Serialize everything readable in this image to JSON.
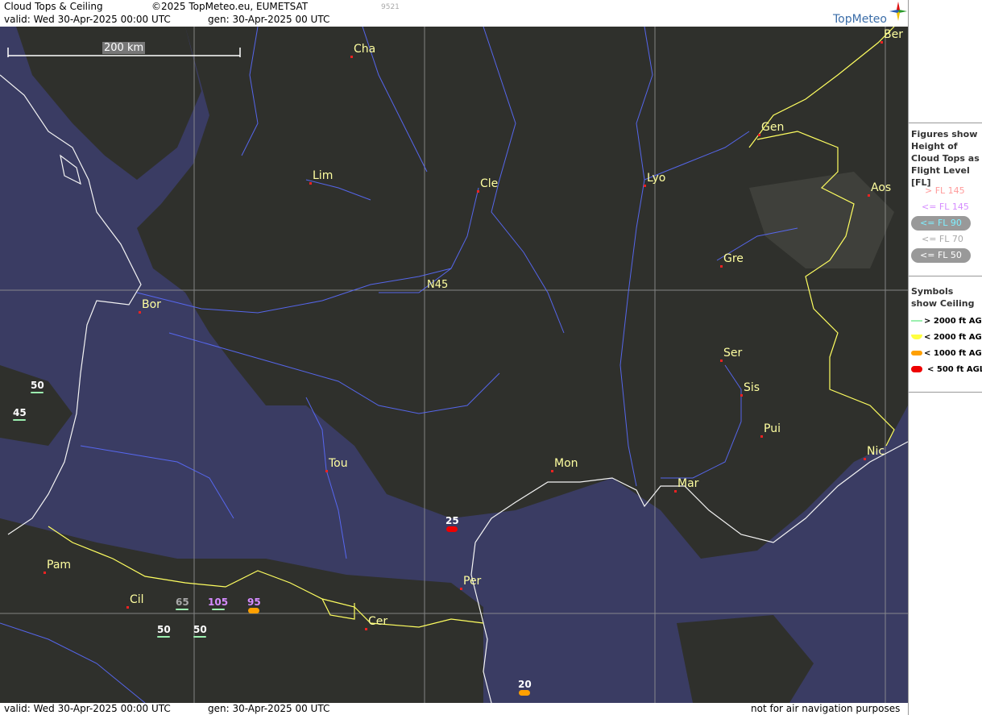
{
  "header": {
    "title": "Cloud Tops & Ceiling",
    "copyright": "©2025 TopMeteo.eu, EUMETSAT",
    "id_code": "9521",
    "valid": "valid:  Wed  30-Apr-2025  00:00 UTC",
    "generated": "gen: 30-Apr-2025 00 UTC",
    "logo": "TopMeteo"
  },
  "footer": {
    "valid": "valid:  Wed  30-Apr-2025  00:00 UTC",
    "generated": "gen: 30-Apr-2025 00 UTC",
    "disclaimer": "not for air navigation purposes"
  },
  "map": {
    "scale_label": "200 km",
    "lat_label": "N45",
    "colors": {
      "sea": "#3a3c63",
      "cloud": "#2e2e2c",
      "river": "#5a6cff",
      "border": "#ffff60",
      "coast": "#ffffff",
      "grid": "#9a9a9a"
    },
    "cities": [
      {
        "name": "Cha"
      },
      {
        "name": "Ber"
      },
      {
        "name": "Gen"
      },
      {
        "name": "Lim"
      },
      {
        "name": "Cle"
      },
      {
        "name": "Lyo"
      },
      {
        "name": "Aos"
      },
      {
        "name": "Gre"
      },
      {
        "name": "Bor"
      },
      {
        "name": "Ser"
      },
      {
        "name": "Sis"
      },
      {
        "name": "Pui"
      },
      {
        "name": "Nic"
      },
      {
        "name": "Tou"
      },
      {
        "name": "Mon"
      },
      {
        "name": "Mar"
      },
      {
        "name": "Pam"
      },
      {
        "name": "Cil"
      },
      {
        "name": "Cer"
      },
      {
        "name": "Per"
      }
    ],
    "observations": [
      {
        "fl": "50",
        "fl_class": "<= FL 50",
        "ceiling": "> 2000 ft AGL"
      },
      {
        "fl": "45",
        "fl_class": "<= FL 50",
        "ceiling": "> 2000 ft AGL"
      },
      {
        "fl": "65",
        "fl_class": "<= FL 70",
        "ceiling": "> 2000 ft AGL"
      },
      {
        "fl": "105",
        "fl_class": "<= FL 145",
        "ceiling": "> 2000 ft AGL"
      },
      {
        "fl": "95",
        "fl_class": "<= FL 145",
        "ceiling": "< 1000 ft AGL"
      },
      {
        "fl": "50",
        "fl_class": "<= FL 50",
        "ceiling": "> 2000 ft AGL"
      },
      {
        "fl": "50",
        "fl_class": "<= FL 50",
        "ceiling": "> 2000 ft AGL"
      },
      {
        "fl": "25",
        "fl_class": "<= FL 50",
        "ceiling": "< 500 ft AGL"
      },
      {
        "fl": "20",
        "fl_class": "<= FL 50",
        "ceiling": "< 1000 ft AGL"
      }
    ]
  },
  "legend": {
    "figures_title": "Figures show Height of Cloud Tops as Flight Level  [FL]",
    "fl_items": [
      {
        "label": "> FL 145",
        "color": "#ff9b9b"
      },
      {
        "label": "<= FL 145",
        "color": "#d58cff"
      },
      {
        "label": "<= FL 90",
        "color": "#7ff0ff"
      },
      {
        "label": "<= FL 70",
        "color": "#a8a8a8"
      },
      {
        "label": "<= FL 50",
        "color": "#ffffff"
      }
    ],
    "symbols_title": "Symbols show Ceiling",
    "ceiling_items": [
      {
        "label": "> 2000 ft AGL",
        "color": "#9cf0b0"
      },
      {
        "label": "< 2000 ft AGL",
        "color": "#ffff40"
      },
      {
        "label": "< 1000 ft AGL",
        "color": "#ffa000"
      },
      {
        "label": "< 500 ft AGL",
        "color": "#ee0000"
      }
    ]
  }
}
